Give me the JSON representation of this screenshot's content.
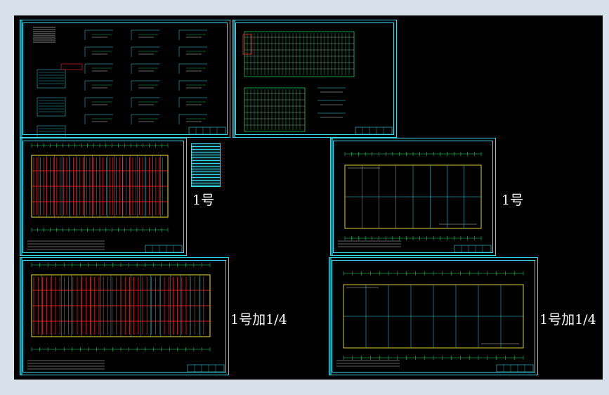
{
  "labels": {
    "plan_mid_left": "1号",
    "plan_mid_right": "1号",
    "plan_bottom_left": "1号加1/4",
    "plan_bottom_right": "1号加1/4"
  },
  "colors": {
    "background": "#000000",
    "frame": "#38d6e6",
    "red": "#ff2a2a",
    "green": "#22e36a",
    "yellow": "#f2e23a",
    "white": "#ffffff"
  }
}
